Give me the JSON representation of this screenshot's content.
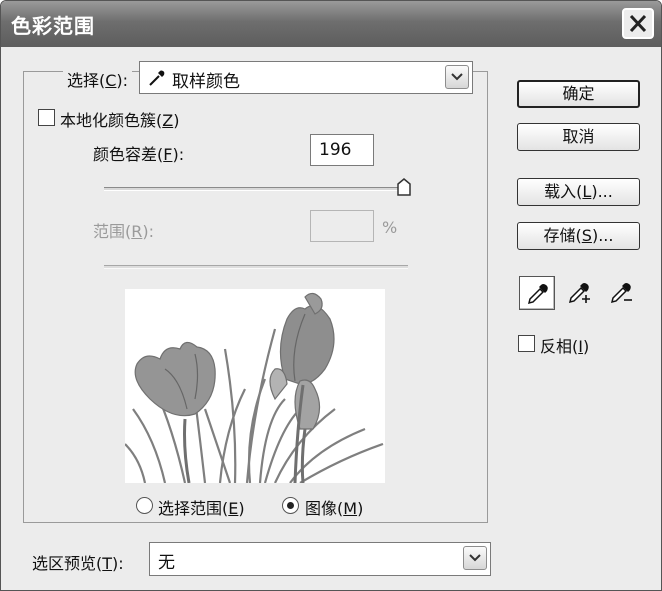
{
  "window": {
    "title": "色彩范围",
    "close_label": "×"
  },
  "select": {
    "label_pre": "选择(",
    "label_key": "C",
    "label_post": "):",
    "value": "取样颜色",
    "value_icon": "eyedropper-icon"
  },
  "localized_clusters": {
    "label_pre": "本地化颜色簇(",
    "label_key": "Z",
    "label_post": ")",
    "checked": false
  },
  "fuzziness": {
    "label_pre": "颜色容差(",
    "label_key": "F",
    "label_post": "):",
    "value": "196",
    "slider_fraction": 0.98
  },
  "range": {
    "label_pre": "范围(",
    "label_key": "R",
    "label_post": "):",
    "value": "",
    "unit": "%"
  },
  "view_mode": {
    "options": [
      {
        "label_pre": "选择范围(",
        "label_key": "E",
        "label_post": ")",
        "selected": false
      },
      {
        "label_pre": "图像(",
        "label_key": "M",
        "label_post": ")",
        "selected": true
      }
    ]
  },
  "selection_preview": {
    "label_pre": "选区预览(",
    "label_key": "T",
    "label_post": "):",
    "value": "无"
  },
  "buttons": {
    "ok": "确定",
    "cancel": "取消",
    "load_pre": "载入(",
    "load_key": "L",
    "load_post": ")...",
    "save_pre": "存储(",
    "save_key": "S",
    "save_post": ")..."
  },
  "eyedroppers": [
    "eyedropper-icon",
    "eyedropper-plus-icon",
    "eyedropper-minus-icon"
  ],
  "invert": {
    "label_pre": "反相(",
    "label_key": "I",
    "label_post": ")",
    "checked": false
  }
}
